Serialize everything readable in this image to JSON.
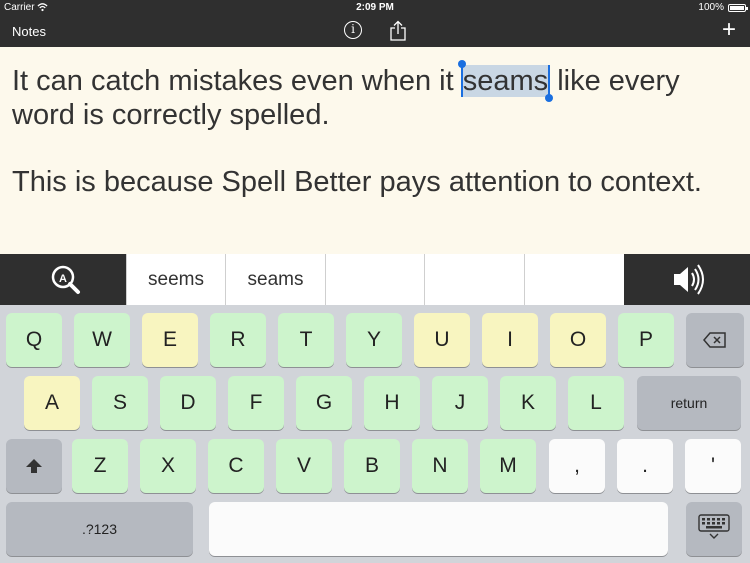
{
  "status_bar": {
    "carrier": "Carrier",
    "time": "2:09 PM",
    "battery": "100%"
  },
  "nav_bar": {
    "notes_label": "Notes",
    "info_icon": "info-icon",
    "share_icon": "share-icon",
    "add_icon": "plus-icon"
  },
  "editor": {
    "line1_before": "It can catch mistakes even when it ",
    "selected_word": "seams",
    "line1_after": " like every word is correctly spelled.",
    "paragraph2": "This is because Spell Better pays attention to context."
  },
  "suggestions": {
    "zoom_icon": "magnifier-icon",
    "items": [
      "seems",
      "seams",
      "",
      "",
      ""
    ],
    "speaker_icon": "speaker-icon"
  },
  "keyboard": {
    "row1": [
      "Q",
      "W",
      "E",
      "R",
      "T",
      "Y",
      "U",
      "I",
      "O",
      "P"
    ],
    "row2": [
      "A",
      "S",
      "D",
      "F",
      "G",
      "H",
      "J",
      "K",
      "L"
    ],
    "row3": [
      "Z",
      "X",
      "C",
      "V",
      "B",
      "N",
      "M",
      ",",
      "."
    ],
    "apostrophe": "'",
    "return_label": "return",
    "numbers_label": ".?123",
    "shift_icon": "shift-icon",
    "backspace_icon": "backspace-icon",
    "hide_keyboard_icon": "keyboard-hide-icon",
    "colors": {
      "vowel": "#f8f5c0",
      "consonant": "#cdf4cc",
      "function": "#b5b9c0",
      "punctuation": "#fbfbfb"
    }
  },
  "colors": {
    "bar": "#2f2f2f",
    "editor_bg": "#fdf9ec",
    "selection": "#c9d7e4",
    "caret": "#1a6fe0"
  }
}
